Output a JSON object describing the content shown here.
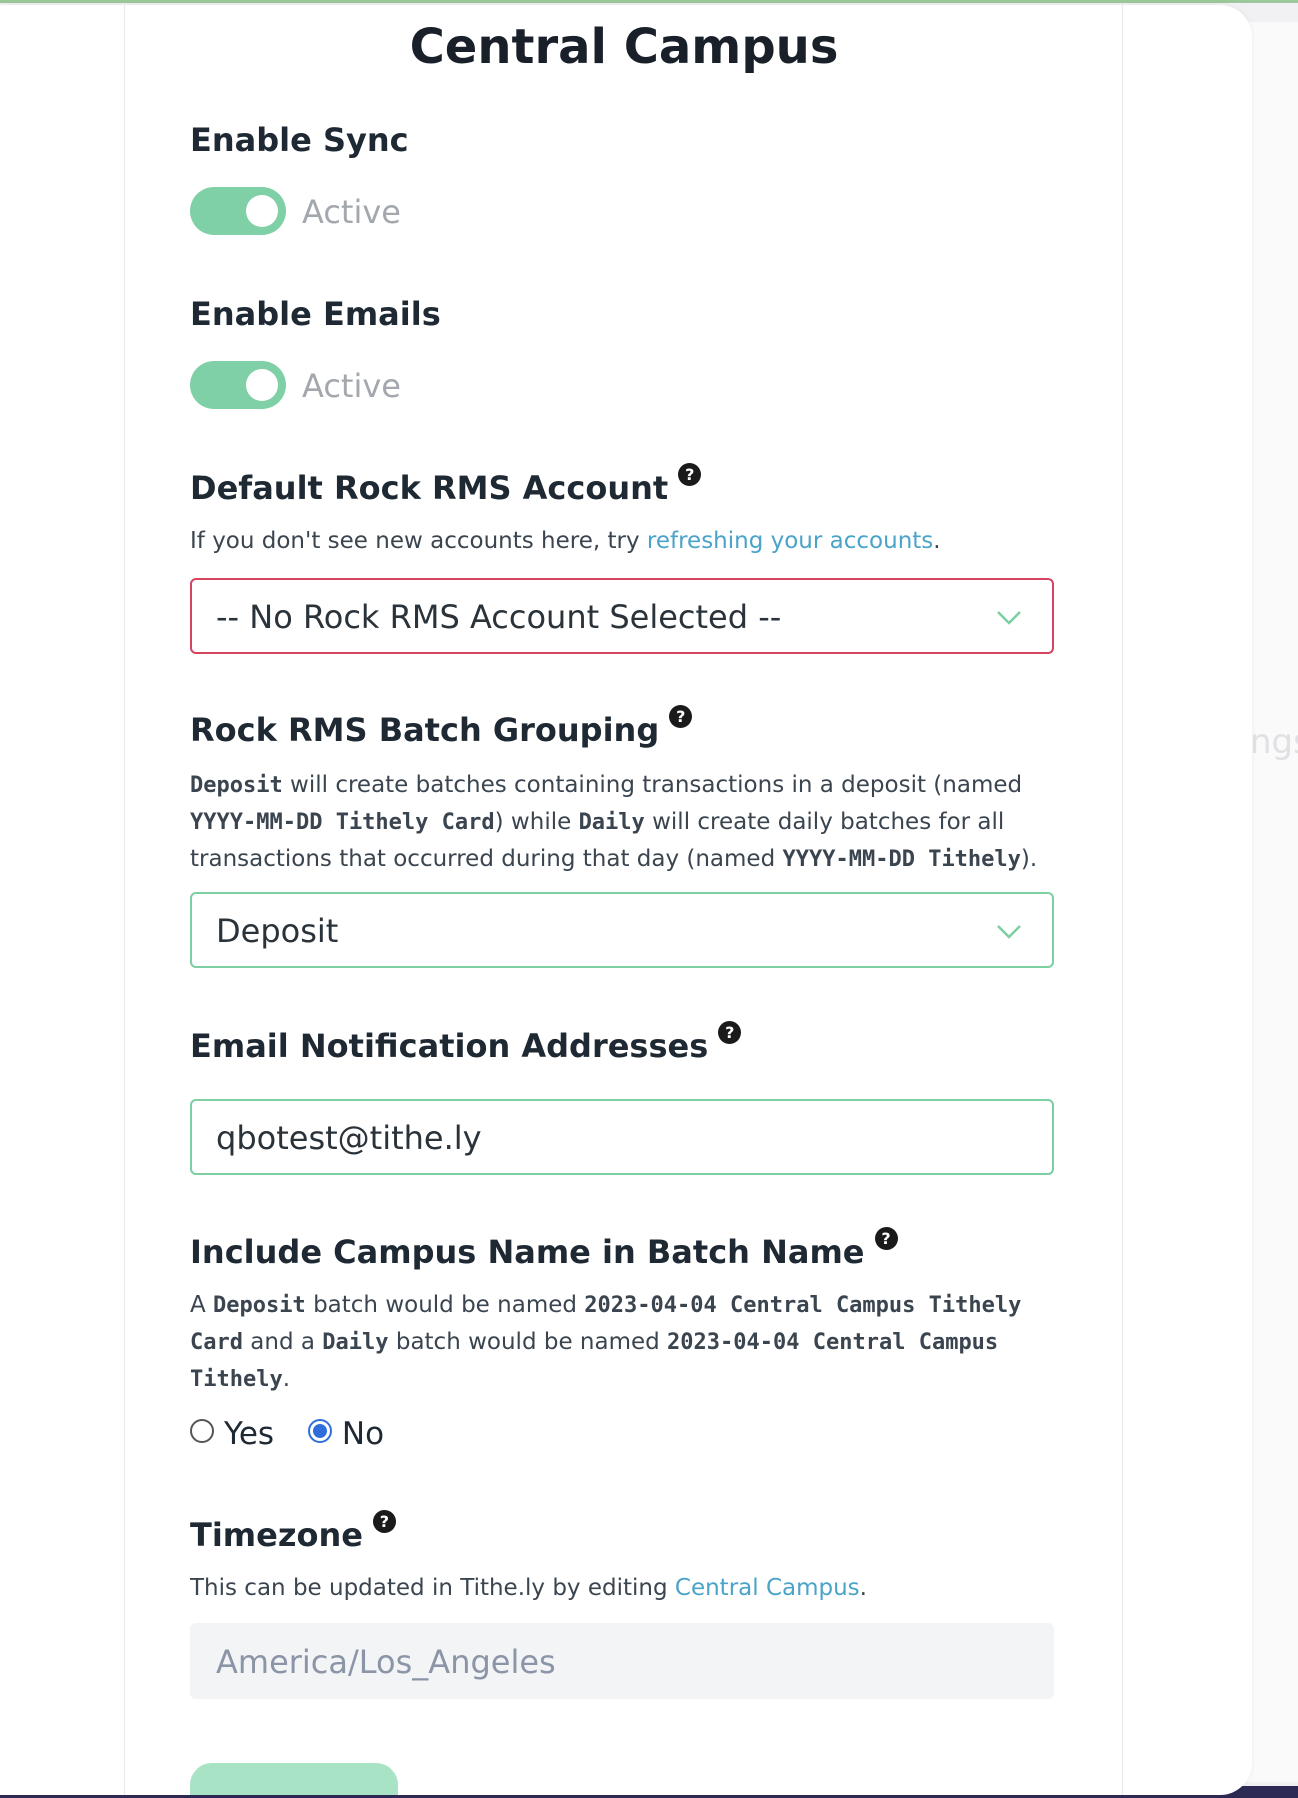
{
  "title": "Central Campus",
  "background_fragment": "ngs",
  "enable_sync": {
    "label": "Enable Sync",
    "status": "Active",
    "on": true
  },
  "enable_emails": {
    "label": "Enable Emails",
    "status": "Active",
    "on": true
  },
  "default_account": {
    "label": "Default Rock RMS Account",
    "help": "?",
    "desc_prefix": "If you don't see new accounts here, try ",
    "desc_link": "refreshing your accounts",
    "desc_suffix": ".",
    "selected": "-- No Rock RMS Account Selected --"
  },
  "batch_grouping": {
    "label": "Rock RMS Batch Grouping",
    "help": "?",
    "desc": {
      "c1": "Deposit",
      "t1": " will create batches containing transactions in a deposit (named ",
      "c2": "YYYY-MM-DD Tithely Card",
      "t2": ") while ",
      "c3": "Daily",
      "t3": " will create daily batches for all transactions that occurred during that day (named ",
      "c4": "YYYY-MM-DD Tithely",
      "t4": ")."
    },
    "selected": "Deposit"
  },
  "email_addresses": {
    "label": "Email Notification Addresses",
    "help": "?",
    "value": "qbotest@tithe.ly"
  },
  "campus_name": {
    "label": "Include Campus Name in Batch Name",
    "help": "?",
    "desc": {
      "t0": "A ",
      "c1": "Deposit",
      "t1": " batch would be named ",
      "c2": "2023-04-04 Central Campus Tithely Card",
      "t2": " and a ",
      "c3": "Daily",
      "t3": " batch would be named ",
      "c4": "2023-04-04 Central Campus Tithely",
      "t4": "."
    },
    "options": [
      "Yes",
      "No"
    ],
    "selected": "No"
  },
  "timezone": {
    "label": "Timezone",
    "help": "?",
    "desc_prefix": "This can be updated in Tithe.ly by editing ",
    "desc_link": "Central Campus",
    "desc_suffix": ".",
    "value": "America/Los_Angeles"
  },
  "colors": {
    "toggle_on": "#7fd0a6",
    "error_border": "#d64560",
    "valid_border": "#7ccfa1",
    "link": "#4aa3c8",
    "radio_selected": "#2f6fdc"
  }
}
